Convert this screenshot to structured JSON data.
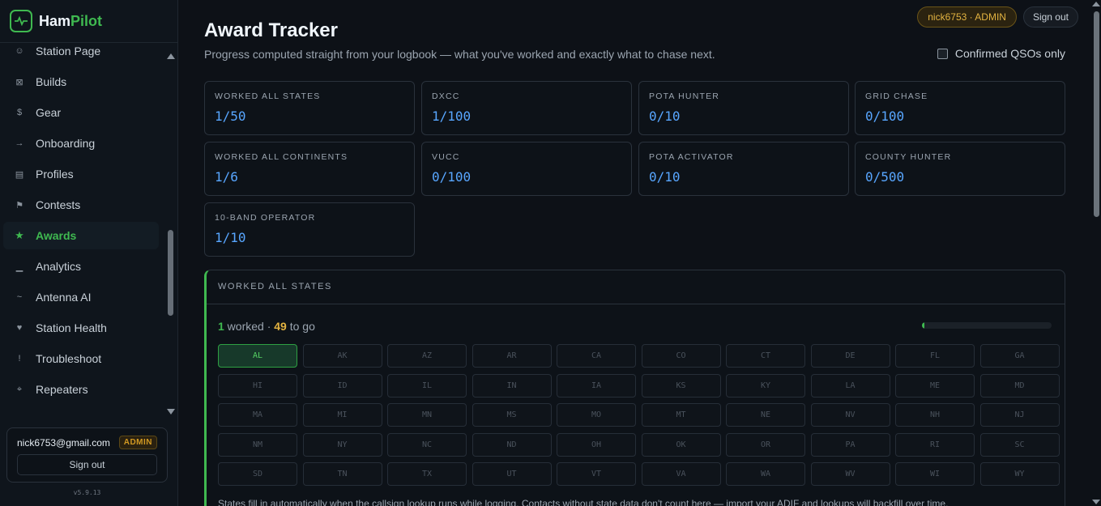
{
  "brand": {
    "name_main": "Ham",
    "name_accent": "Pilot"
  },
  "sidebar": {
    "items": [
      {
        "icon": "☺",
        "label": "Station Page",
        "active": false
      },
      {
        "icon": "⊠",
        "label": "Builds",
        "active": false
      },
      {
        "icon": "$",
        "label": "Gear",
        "active": false
      },
      {
        "icon": "→",
        "label": "Onboarding",
        "active": false
      },
      {
        "icon": "▤",
        "label": "Profiles",
        "active": false
      },
      {
        "icon": "⚑",
        "label": "Contests",
        "active": false
      },
      {
        "icon": "★",
        "label": "Awards",
        "active": true
      },
      {
        "icon": "▁",
        "label": "Analytics",
        "active": false
      },
      {
        "icon": "~",
        "label": "Antenna AI",
        "active": false
      },
      {
        "icon": "♥",
        "label": "Station Health",
        "active": false
      },
      {
        "icon": "!",
        "label": "Troubleshoot",
        "active": false
      },
      {
        "icon": "⌖",
        "label": "Repeaters",
        "active": false
      }
    ],
    "user_email": "nick6753@gmail.com",
    "admin_badge": "ADMIN",
    "sign_out": "Sign out",
    "version": "v5.9.13"
  },
  "header": {
    "title": "Award Tracker",
    "subtitle": "Progress computed straight from your logbook — what you've worked and exactly what to chase next.",
    "user_pill": "nick6753 · ADMIN",
    "sign_out": "Sign out",
    "confirmed_label": "Confirmed QSOs only",
    "confirmed_checked": false
  },
  "awards": [
    {
      "name": "WORKED ALL STATES",
      "value": "1/50"
    },
    {
      "name": "DXCC",
      "value": "1/100"
    },
    {
      "name": "POTA HUNTER",
      "value": "0/10"
    },
    {
      "name": "GRID CHASE",
      "value": "0/100"
    },
    {
      "name": "WORKED ALL CONTINENTS",
      "value": "1/6"
    },
    {
      "name": "VUCC",
      "value": "0/100"
    },
    {
      "name": "POTA ACTIVATOR",
      "value": "0/10"
    },
    {
      "name": "COUNTY HUNTER",
      "value": "0/500"
    },
    {
      "name": "10-BAND OPERATOR",
      "value": "1/10"
    }
  ],
  "was_section": {
    "title": "WORKED ALL STATES",
    "worked_count": "1",
    "worked_label": " worked · ",
    "to_go_count": "49",
    "to_go_label": " to go",
    "progress_fraction": 0.02,
    "states": [
      "AL",
      "AK",
      "AZ",
      "AR",
      "CA",
      "CO",
      "CT",
      "DE",
      "FL",
      "GA",
      "HI",
      "ID",
      "IL",
      "IN",
      "IA",
      "KS",
      "KY",
      "LA",
      "ME",
      "MD",
      "MA",
      "MI",
      "MN",
      "MS",
      "MO",
      "MT",
      "NE",
      "NV",
      "NH",
      "NJ",
      "NM",
      "NY",
      "NC",
      "ND",
      "OH",
      "OK",
      "OR",
      "PA",
      "RI",
      "SC",
      "SD",
      "TN",
      "TX",
      "UT",
      "VT",
      "VA",
      "WA",
      "WV",
      "WI",
      "WY"
    ],
    "worked_states": [
      "AL"
    ],
    "note": "States fill in automatically when the callsign lookup runs while logging. Contacts without state data don't count here — import your ADIF and lookups will backfill over time."
  },
  "colors": {
    "accent": "#3fb950",
    "value_blue": "#58a6ff",
    "admin_gold": "#e3b341"
  }
}
